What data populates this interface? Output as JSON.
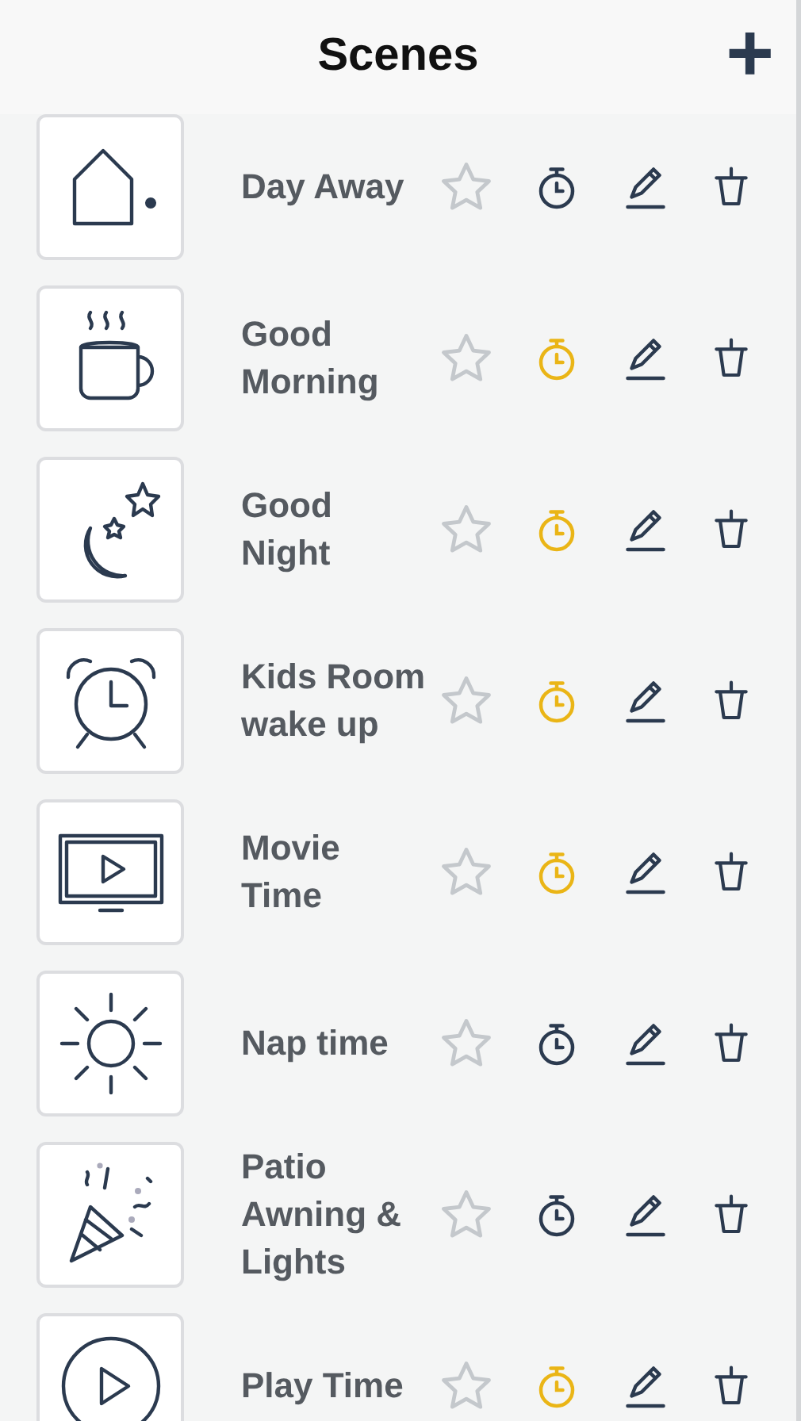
{
  "header": {
    "title": "Scenes",
    "add_button": "+"
  },
  "scenes": [
    {
      "name": "Day Away",
      "favorite": false,
      "timer_active": false
    },
    {
      "name": "Good Morning",
      "favorite": false,
      "timer_active": true
    },
    {
      "name": "Good Night",
      "favorite": false,
      "timer_active": true
    },
    {
      "name": "Kids Room wake up",
      "favorite": false,
      "timer_active": true
    },
    {
      "name": "Movie Time",
      "favorite": false,
      "timer_active": true
    },
    {
      "name": "Nap time",
      "favorite": false,
      "timer_active": false
    },
    {
      "name": "Patio Awning & Lights",
      "favorite": false,
      "timer_active": false
    },
    {
      "name": "Play Time",
      "favorite": false,
      "timer_active": true
    }
  ]
}
